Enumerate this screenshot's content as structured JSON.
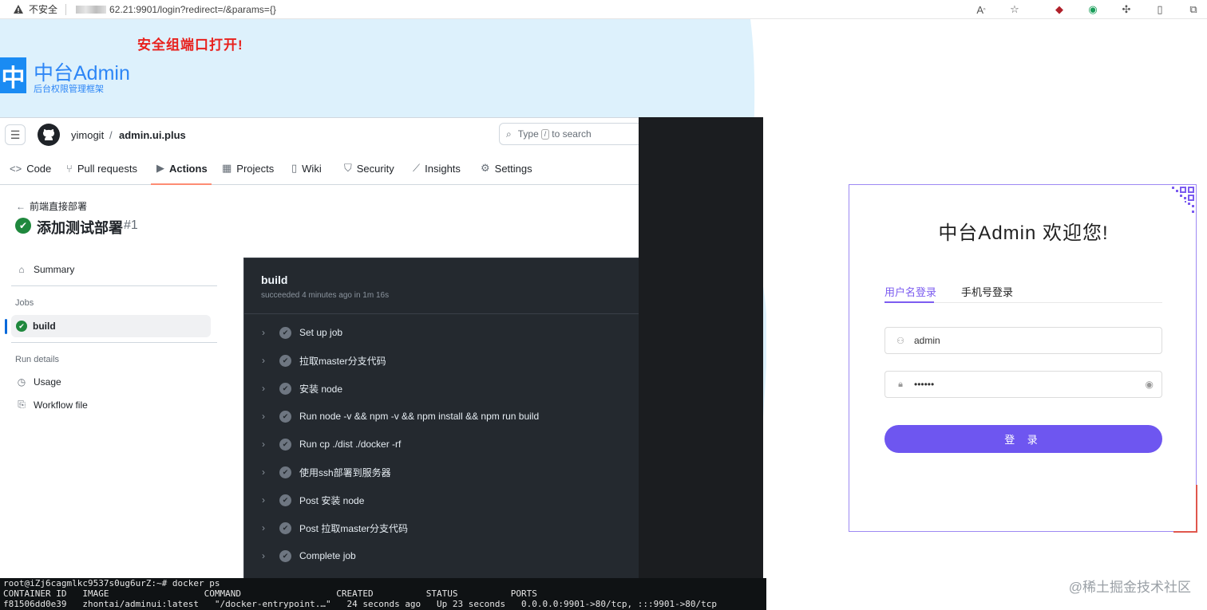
{
  "browser": {
    "insecure_label": "不安全",
    "url_text": "62.21:9901/login?redirect=/&params={}"
  },
  "admin": {
    "security_note": "安全组端口打开!",
    "logo_glyph": "中",
    "title": "中台Admin",
    "subtitle": "后台权限管理框架",
    "bg_color": "#ddf1fc"
  },
  "github": {
    "owner": "yimogit",
    "slash": "/",
    "repo": "admin.ui.plus",
    "search": {
      "prefix": "Type",
      "key": "/",
      "suffix": "to search"
    },
    "tabs": [
      {
        "label": "Code",
        "icon": "code-icon"
      },
      {
        "label": "Pull requests",
        "icon": "pull-request-icon"
      },
      {
        "label": "Actions",
        "icon": "play-icon",
        "active": true
      },
      {
        "label": "Projects",
        "icon": "table-icon"
      },
      {
        "label": "Wiki",
        "icon": "book-icon"
      },
      {
        "label": "Security",
        "icon": "shield-icon"
      },
      {
        "label": "Insights",
        "icon": "graph-icon"
      },
      {
        "label": "Settings",
        "icon": "gear-icon"
      }
    ],
    "back_link": "前端直接部署",
    "run_title": "添加测试部署",
    "run_number": "#1",
    "sidebar": {
      "summary": "Summary",
      "jobs_heading": "Jobs",
      "build": "build",
      "run_details_heading": "Run details",
      "usage": "Usage",
      "workflow_file": "Workflow file"
    },
    "log": {
      "title": "build",
      "subtitle": "succeeded 4 minutes ago in 1m 16s",
      "steps": [
        "Set up job",
        "拉取master分支代码",
        "安装 node",
        "Run node -v && npm -v && npm install && npm run build",
        "Run cp ./dist ./docker -rf",
        "使用ssh部署到服务器",
        "Post 安装 node",
        "Post 拉取master分支代码",
        "Complete job"
      ]
    }
  },
  "terminal": {
    "lines": [
      "root@iZj6cagmlkc9537s0ug6urZ:~# docker ps",
      "CONTAINER ID   IMAGE                  COMMAND                  CREATED          STATUS          PORTS",
      "f81506dd0e39   zhontai/adminui:latest   \"/docker-entrypoint.…\"   24 seconds ago   Up 23 seconds   0.0.0.0:9901->80/tcp, :::9901->80/tcp"
    ]
  },
  "login": {
    "title": "中台Admin 欢迎您!",
    "tab_user": "用户名登录",
    "tab_phone": "手机号登录",
    "username": "admin",
    "password": "••••••",
    "submit": "登 录",
    "accent_color": "#6e56f0"
  },
  "watermark": "@稀土掘金技术社区"
}
